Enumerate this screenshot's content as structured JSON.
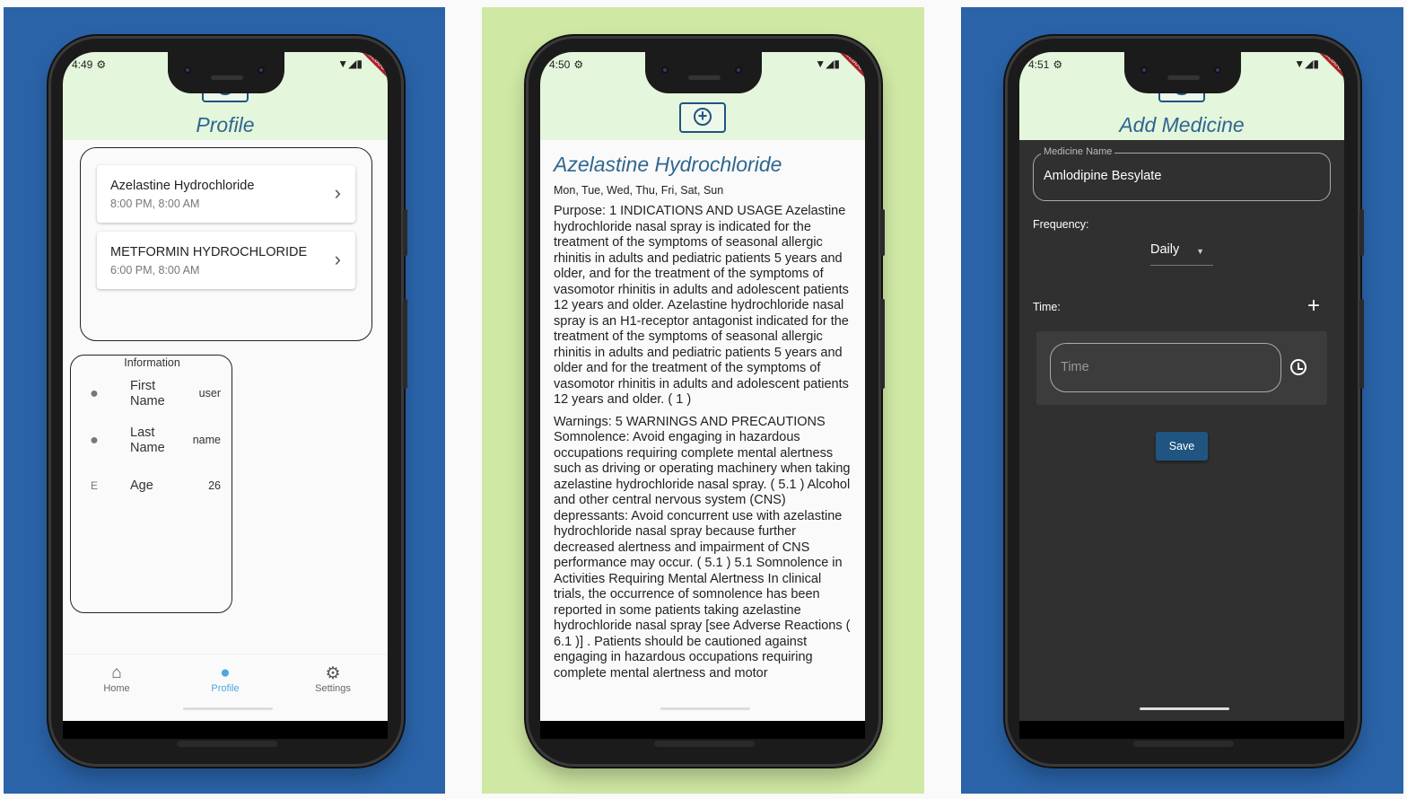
{
  "colors": {
    "panel_left": "#2a63a8",
    "panel_mid": "#cfe8a4",
    "panel_right": "#2a63a8",
    "accent": "#2f6790",
    "appbar": "#e4f6dc",
    "nav_active": "#4aa8e0"
  },
  "profile_screen": {
    "status_time": "4:49",
    "debug_banner": "DEBUG",
    "title": "Profile",
    "medicines": [
      {
        "name": "Azelastine Hydrochloride",
        "times": "8:00 PM, 8:00 AM"
      },
      {
        "name": "METFORMIN HYDROCHLORIDE",
        "times": "6:00 PM, 8:00 AM"
      }
    ],
    "info": {
      "title": "Information",
      "rows": [
        {
          "icon": "person-icon",
          "label": "First Name",
          "value": "user"
        },
        {
          "icon": "person-icon",
          "label": "Last Name",
          "value": "name"
        },
        {
          "icon": "letter-e-icon",
          "icon_glyph": "E",
          "label": "Age",
          "value": "26"
        }
      ]
    },
    "nav": [
      {
        "label": "Home",
        "icon": "home-icon"
      },
      {
        "label": "Profile",
        "icon": "person-icon"
      },
      {
        "label": "Settings",
        "icon": "gear-icon"
      }
    ]
  },
  "detail_screen": {
    "status_time": "4:50",
    "debug_banner": "DEBUG",
    "title": "Azelastine Hydrochloride",
    "days": "Mon, Tue, Wed, Thu, Fri, Sat, Sun",
    "purpose": "Purpose: 1 INDICATIONS AND USAGE Azelastine hydrochloride nasal spray is indicated for the treatment of the symptoms of seasonal allergic rhinitis in adults and pediatric patients 5 years and older, and for the treatment of the symptoms of vasomotor rhinitis in adults and adolescent patients 12 years and older. Azelastine hydrochloride nasal spray is an H1-receptor antagonist indicated for the treatment of the symptoms of seasonal allergic rhinitis in adults and pediatric patients 5 years and older and for the treatment of the symptoms of vasomotor rhinitis in adults and adolescent patients 12 years and older. ( 1 )",
    "warnings": "Warnings: 5 WARNINGS AND PRECAUTIONS Somnolence: Avoid engaging in hazardous occupations requiring complete mental alertness such as driving or operating machinery when taking azelastine hydrochloride nasal spray. ( 5.1 ) Alcohol and other central nervous system (CNS) depressants: Avoid concurrent use with azelastine hydrochloride nasal spray because further decreased alertness and impairment of CNS performance may occur. ( 5.1 ) 5.1 Somnolence in Activities Requiring Mental Alertness In clinical trials, the occurrence of somnolence has been reported in some patients taking azelastine hydrochloride nasal spray [see Adverse Reactions ( 6.1 )] . Patients should be cautioned against engaging in hazardous occupations requiring complete mental alertness and motor"
  },
  "add_screen": {
    "status_time": "4:51",
    "debug_banner": "DEBUG",
    "title": "Add Medicine",
    "medicine_name_label": "Medicine Name",
    "medicine_name_value": "Amlodipine Besylate",
    "frequency_label": "Frequency:",
    "frequency_value": "Daily",
    "time_label": "Time:",
    "add_time_glyph": "+",
    "time_placeholder": "Time",
    "save_label": "Save"
  }
}
